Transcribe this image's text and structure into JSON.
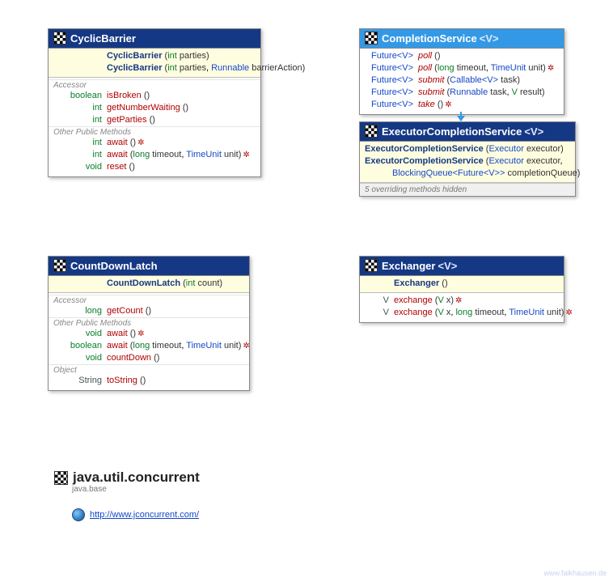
{
  "cyclicBarrier": {
    "title": "CyclicBarrier",
    "ctor1_name": "CyclicBarrier",
    "ctor1_p1_type": "int",
    "ctor1_p1_name": "parties",
    "ctor2_name": "CyclicBarrier",
    "ctor2_p1_type": "int",
    "ctor2_p1_name": "parties",
    "ctor2_p2_type": "Runnable",
    "ctor2_p2_name": "barrierAction",
    "sec1": "Accessor",
    "m1_ret": "boolean",
    "m1_name": "isBroken",
    "m2_ret": "int",
    "m2_name": "getNumberWaiting",
    "m3_ret": "int",
    "m3_name": "getParties",
    "sec2": "Other Public Methods",
    "m4_ret": "int",
    "m4_name": "await",
    "m5_ret": "int",
    "m5_name": "await",
    "m5_p1_type": "long",
    "m5_p1_name": "timeout",
    "m5_p2_type": "TimeUnit",
    "m5_p2_name": "unit",
    "m6_ret": "void",
    "m6_name": "reset"
  },
  "completionService": {
    "title": "CompletionService",
    "gen": "<V>",
    "m1_ret": "Future<V>",
    "m1_name": "poll",
    "m2_ret": "Future<V>",
    "m2_name": "poll",
    "m2_p1_type": "long",
    "m2_p1_name": "timeout",
    "m2_p2_type": "TimeUnit",
    "m2_p2_name": "unit",
    "m3_ret": "Future<V>",
    "m3_name": "submit",
    "m3_p1_type": "Callable<V>",
    "m3_p1_name": "task",
    "m4_ret": "Future<V>",
    "m4_name": "submit",
    "m4_p1_type": "Runnable",
    "m4_p1_name": "task",
    "m4_p2_type": "V",
    "m4_p2_name": "result",
    "m5_ret": "Future<V>",
    "m5_name": "take"
  },
  "executorCompletionService": {
    "title": "ExecutorCompletionService",
    "gen": "<V>",
    "ctor1_name": "ExecutorCompletionService",
    "ctor1_p1_type": "Executor",
    "ctor1_p1_name": "executor",
    "ctor2_name": "ExecutorCompletionService",
    "ctor2_p1_type": "Executor",
    "ctor2_p1_name": "executor",
    "ctor2_line2_p1_type": "BlockingQueue<Future<V>>",
    "ctor2_line2_p1_name": "completionQueue",
    "hidden": "5 overriding methods hidden"
  },
  "countDownLatch": {
    "title": "CountDownLatch",
    "ctor1_name": "CountDownLatch",
    "ctor1_p1_type": "int",
    "ctor1_p1_name": "count",
    "sec1": "Accessor",
    "m1_ret": "long",
    "m1_name": "getCount",
    "sec2": "Other Public Methods",
    "m2_ret": "void",
    "m2_name": "await",
    "m3_ret": "boolean",
    "m3_name": "await",
    "m3_p1_type": "long",
    "m3_p1_name": "timeout",
    "m3_p2_type": "TimeUnit",
    "m3_p2_name": "unit",
    "m4_ret": "void",
    "m4_name": "countDown",
    "sec3": "Object",
    "m5_ret": "String",
    "m5_name": "toString"
  },
  "exchanger": {
    "title": "Exchanger",
    "gen": "<V>",
    "ctor1_name": "Exchanger",
    "m1_ret": "V",
    "m1_name": "exchange",
    "m1_p1_type": "V",
    "m1_p1_name": "x",
    "m2_ret": "V",
    "m2_name": "exchange",
    "m2_p1_type": "V",
    "m2_p1_name": "x",
    "m2_p2_type": "long",
    "m2_p2_name": "timeout",
    "m2_p3_type": "TimeUnit",
    "m2_p3_name": "unit"
  },
  "pkg": {
    "title": "java.util.concurrent",
    "sub": "java.base",
    "url": "http://www.jconcurrent.com/"
  },
  "watermark": "www.falkhausen.de"
}
